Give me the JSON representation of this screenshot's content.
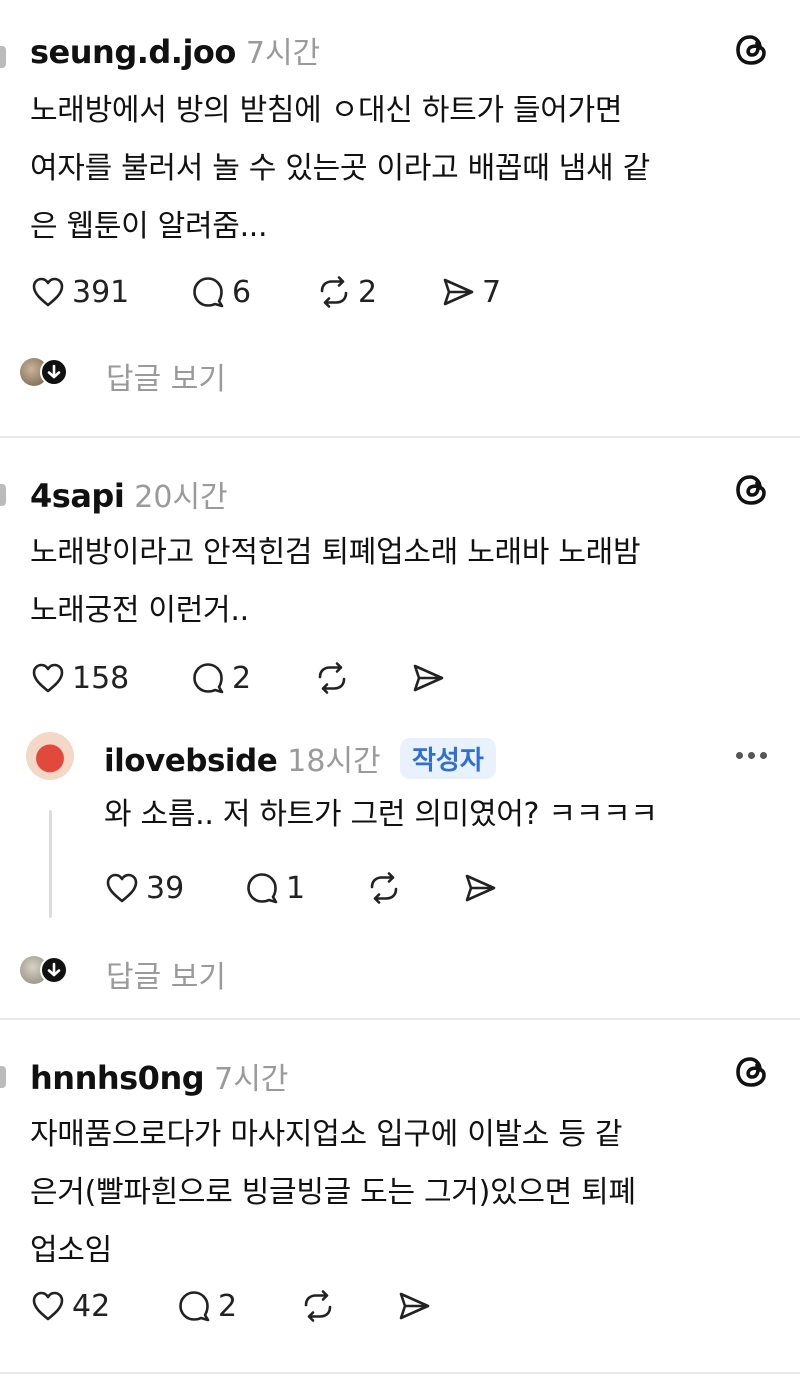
{
  "posts": [
    {
      "username": "seung.d.joo",
      "time": "7시간",
      "lines": [
        "노래방에서 방의 받침에 ㅇ대신 하트가 들어가면",
        "여자를 불러서 놀 수 있는곳 이라고 배꼽때 냄새 같",
        "은 웹툰이 알려줌..."
      ],
      "likes": "391",
      "comments": "6",
      "reposts": "2",
      "shares": "7",
      "view_replies": "답글 보기"
    },
    {
      "username": "4sapi",
      "time": "20시간",
      "lines": [
        "노래방이라고 안적힌검 퇴폐업소래 노래바 노래밤",
        "노래궁전 이런거.."
      ],
      "likes": "158",
      "comments": "2",
      "reply": {
        "username": "ilovebside",
        "time": "18시간",
        "badge": "작성자",
        "text": "와 소름.. 저 하트가 그런 의미였어? ㅋㅋㅋㅋ",
        "likes": "39",
        "comments": "1"
      },
      "view_replies": "답글 보기"
    },
    {
      "username": "hnnhs0ng",
      "time": "7시간",
      "lines": [
        "자매품으로다가 마사지업소 입구에 이발소 등 같",
        "은거(빨파흰으로 빙글빙글 도는 그거)있으면 퇴폐",
        "업소임"
      ],
      "likes": "42",
      "comments": "2"
    }
  ],
  "icons": {
    "like": "heart-icon",
    "comment": "comment-bubble-icon",
    "repost": "repost-icon",
    "share": "send-icon",
    "brand": "threads-logo-icon",
    "more": "more-dots-icon"
  },
  "colors": {
    "muted": "#9a9a9a",
    "badge_text": "#2f6fd0",
    "badge_bg": "#e9f1fc"
  }
}
